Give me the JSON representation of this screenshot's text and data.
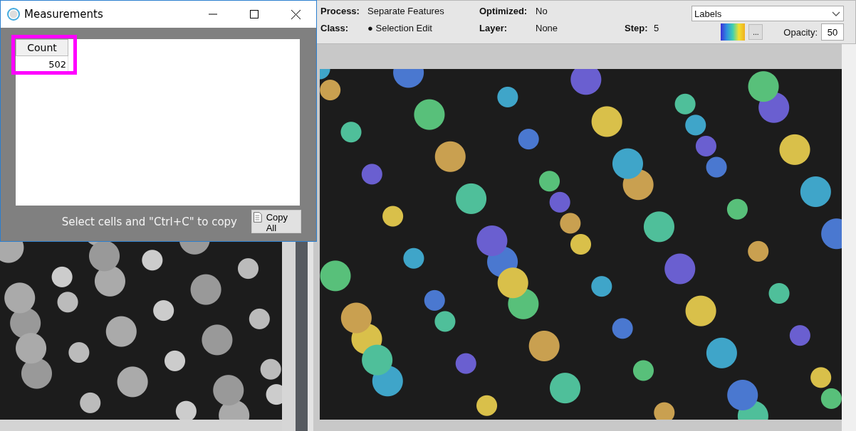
{
  "measurements_window": {
    "title": "Measurements",
    "table": {
      "columns": [
        "Count"
      ],
      "rows": [
        [
          "502"
        ]
      ]
    },
    "hint": "Select cells and \"Ctrl+C\" to copy",
    "copy_button": "Copy All"
  },
  "toolbar": {
    "process_label": "Process:",
    "process": "Separate Features",
    "optimized_label": "Optimized:",
    "optimized": "No",
    "class_label": "Class:",
    "class_marker": "●",
    "class": "Selection Edit",
    "layer_label": "Layer:",
    "layer": "None",
    "step_label": "Step:",
    "step": "5",
    "display_select": "Labels",
    "more_button": "...",
    "opacity_label": "Opacity:",
    "opacity": "50"
  }
}
